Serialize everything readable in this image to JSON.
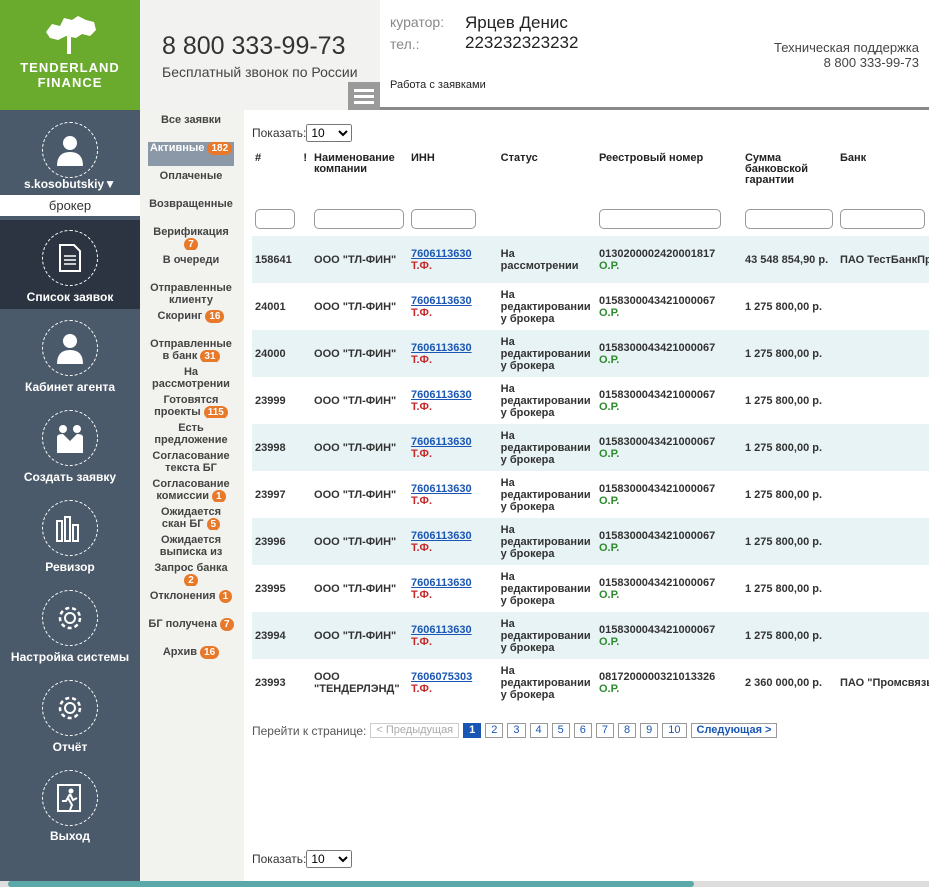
{
  "brand": {
    "name_line1": "TENDERLAND",
    "name_line2": "FINANCE"
  },
  "header": {
    "phone": "8 800 333-99-73",
    "phone_note": "Бесплатный звонок по России",
    "curator_label": "куратор:",
    "curator_name": "Ярцев Денис",
    "tel_label": "тел.:",
    "tel_value": "223232323232",
    "section": "Работа с заявками",
    "support_title": "Техническая поддержка",
    "support_phone": "8 800 333-99-73"
  },
  "sidebar": {
    "user": "s.kosobutskiy▼",
    "role": "брокер",
    "items": [
      {
        "label": "Список заявок",
        "icon": "document-icon"
      },
      {
        "label": "Кабинет агента",
        "icon": "user-icon"
      },
      {
        "label": "Создать заявку",
        "icon": "handshake-icon"
      },
      {
        "label": "Ревизор",
        "icon": "bar-chart-icon"
      },
      {
        "label": "Настройка системы",
        "icon": "gear-icon"
      },
      {
        "label": "Отчёт",
        "icon": "gear-icon"
      },
      {
        "label": "Выход",
        "icon": "exit-icon"
      }
    ]
  },
  "filters": [
    {
      "label": "Все заявки",
      "badge": ""
    },
    {
      "label": "Активные",
      "badge": "182"
    },
    {
      "label": "Оплаченые",
      "badge": ""
    },
    {
      "label": "Возвращенные",
      "badge": ""
    },
    {
      "label": "Верификация",
      "badge": "7"
    },
    {
      "label": "В очереди",
      "badge": ""
    },
    {
      "label": "Отправленные клиенту",
      "badge": ""
    },
    {
      "label": "Скоринг",
      "badge": "16"
    },
    {
      "label": "Отправленные в банк",
      "badge": "31"
    },
    {
      "label": "На рассмотрении",
      "badge": ""
    },
    {
      "label": "Готовятся проекты",
      "badge": "115"
    },
    {
      "label": "Есть предложение",
      "badge": ""
    },
    {
      "label": "Согласование текста БГ",
      "badge": ""
    },
    {
      "label": "Согласование комиссии",
      "badge": "1"
    },
    {
      "label": "Ожидается скан БГ",
      "badge": "5"
    },
    {
      "label": "Ожидается выписка из",
      "badge": ""
    },
    {
      "label": "Запрос банка",
      "badge": "2"
    },
    {
      "label": "Отклонения",
      "badge": "1"
    },
    {
      "label": "БГ получена",
      "badge": "7"
    },
    {
      "label": "Архив",
      "badge": "16"
    }
  ],
  "list": {
    "show_label": "Показать:",
    "page_size": "10",
    "columns": [
      "#",
      "!",
      "Наименование компании",
      "ИНН",
      "Статус",
      "Реестровый номер",
      "Сумма банковской гарантии",
      "Банк"
    ],
    "rows": [
      {
        "id": "158641",
        "company": "ООО \"ТЛ-ФИН\"",
        "inn": "7606113630",
        "tf": "Т.Ф.",
        "status": "На рассмотрении",
        "reg": "0130200002420001817",
        "or": "О.Р.",
        "sum": "43 548 854,90 р.",
        "bank": "ПАО ТестБанкПром"
      },
      {
        "id": "24001",
        "company": "ООО \"ТЛ-ФИН\"",
        "inn": "7606113630",
        "tf": "Т.Ф.",
        "status": "На редактировании у брокера",
        "reg": "0158300043421000067",
        "or": "О.Р.",
        "sum": "1 275 800,00 р.",
        "bank": ""
      },
      {
        "id": "24000",
        "company": "ООО \"ТЛ-ФИН\"",
        "inn": "7606113630",
        "tf": "Т.Ф.",
        "status": "На редактировании у брокера",
        "reg": "0158300043421000067",
        "or": "О.Р.",
        "sum": "1 275 800,00 р.",
        "bank": ""
      },
      {
        "id": "23999",
        "company": "ООО \"ТЛ-ФИН\"",
        "inn": "7606113630",
        "tf": "Т.Ф.",
        "status": "На редактировании у брокера",
        "reg": "0158300043421000067",
        "or": "О.Р.",
        "sum": "1 275 800,00 р.",
        "bank": ""
      },
      {
        "id": "23998",
        "company": "ООО \"ТЛ-ФИН\"",
        "inn": "7606113630",
        "tf": "Т.Ф.",
        "status": "На редактировании у брокера",
        "reg": "0158300043421000067",
        "or": "О.Р.",
        "sum": "1 275 800,00 р.",
        "bank": ""
      },
      {
        "id": "23997",
        "company": "ООО \"ТЛ-ФИН\"",
        "inn": "7606113630",
        "tf": "Т.Ф.",
        "status": "На редактировании у брокера",
        "reg": "0158300043421000067",
        "or": "О.Р.",
        "sum": "1 275 800,00 р.",
        "bank": ""
      },
      {
        "id": "23996",
        "company": "ООО \"ТЛ-ФИН\"",
        "inn": "7606113630",
        "tf": "Т.Ф.",
        "status": "На редактировании у брокера",
        "reg": "0158300043421000067",
        "or": "О.Р.",
        "sum": "1 275 800,00 р.",
        "bank": ""
      },
      {
        "id": "23995",
        "company": "ООО \"ТЛ-ФИН\"",
        "inn": "7606113630",
        "tf": "Т.Ф.",
        "status": "На редактировании у брокера",
        "reg": "0158300043421000067",
        "or": "О.Р.",
        "sum": "1 275 800,00 р.",
        "bank": ""
      },
      {
        "id": "23994",
        "company": "ООО \"ТЛ-ФИН\"",
        "inn": "7606113630",
        "tf": "Т.Ф.",
        "status": "На редактировании у брокера",
        "reg": "0158300043421000067",
        "or": "О.Р.",
        "sum": "1 275 800,00 р.",
        "bank": ""
      },
      {
        "id": "23993",
        "company": "ООО \"ТЕНДЕРЛЭНД\"",
        "inn": "7606075303",
        "tf": "Т.Ф.",
        "status": "На редактировании у брокера",
        "reg": "0817200000321013326",
        "or": "О.Р.",
        "sum": "2 360 000,00 р.",
        "bank": "ПАО \"Промсвязьба"
      }
    ]
  },
  "pager": {
    "label": "Перейти к странице:",
    "prev": "< Предыдущая",
    "next": "Следующая >",
    "pages": [
      "1",
      "2",
      "3",
      "4",
      "5",
      "6",
      "7",
      "8",
      "9",
      "10"
    ],
    "current": "1"
  },
  "colors": {
    "brand_green": "#6aab2e",
    "sidebar": "#4b5a6a",
    "badge": "#e8782a",
    "link": "#1a56b3"
  }
}
